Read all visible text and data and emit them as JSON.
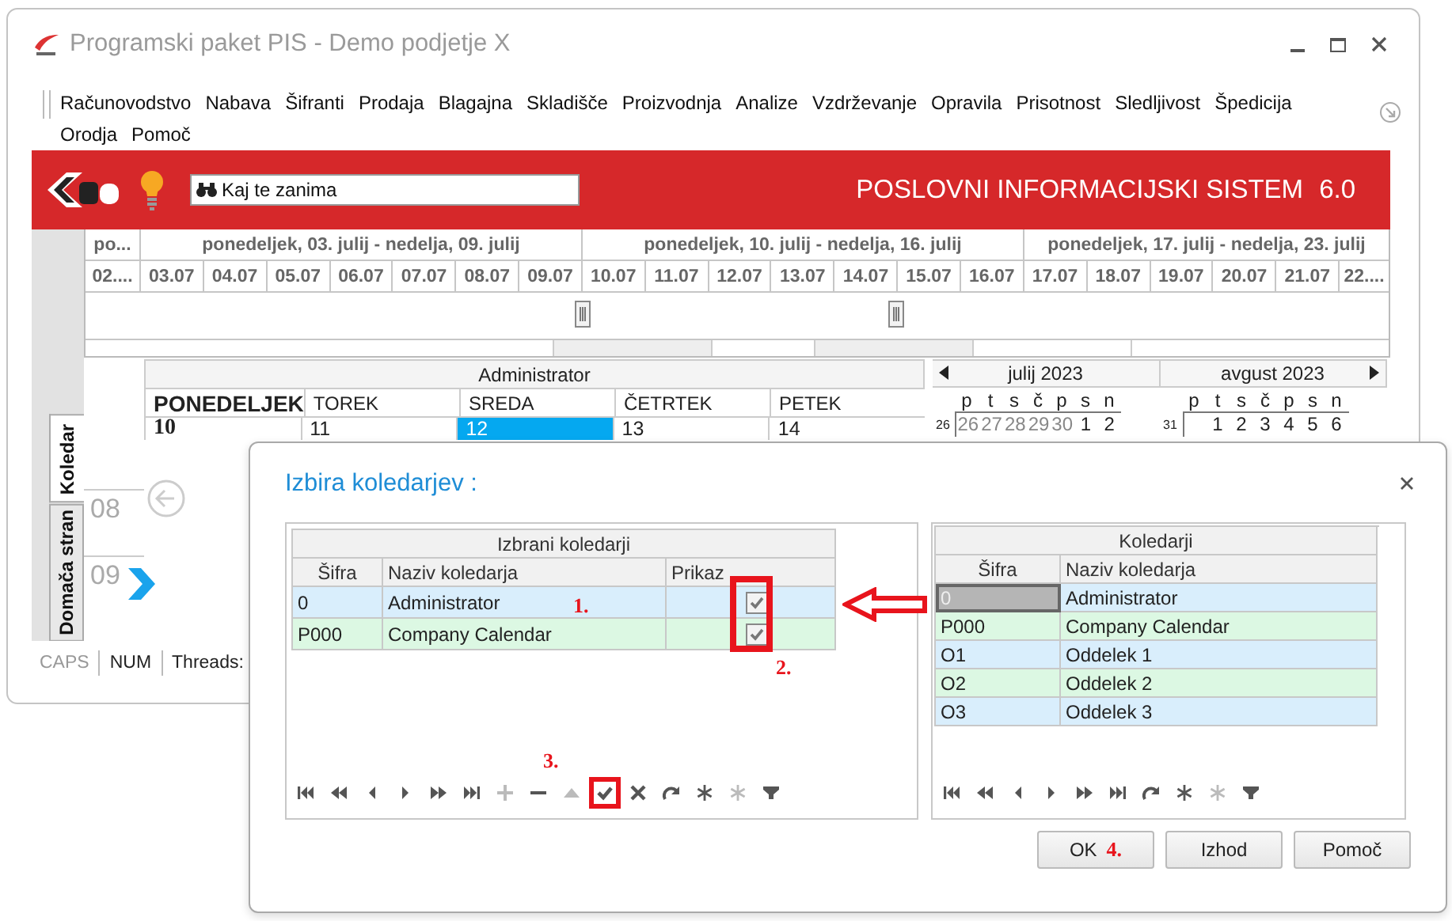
{
  "window": {
    "title": "Programski paket PIS - Demo podjetje X"
  },
  "menu": [
    "Računovodstvo",
    "Nabava",
    "Šifranti",
    "Prodaja",
    "Blagajna",
    "Skladišče",
    "Proizvodnja",
    "Analize",
    "Vzdrževanje",
    "Opravila",
    "Prisotnost",
    "Sledljivost",
    "Špedicija",
    "Orodja",
    "Pomoč"
  ],
  "header": {
    "search": {
      "placeholder": "Kaj te zanima"
    },
    "product": "POSLOVNI INFORMACIJSKI SISTEM",
    "version": "6.0"
  },
  "timeline": {
    "weeks": [
      "po...",
      "ponedeljek, 03. julij - nedelja, 09. julij",
      "ponedeljek, 10. julij - nedelja, 16. julij",
      "ponedeljek, 17. julij - nedelja, 23. julij"
    ],
    "days": [
      "02....",
      "03.07",
      "04.07",
      "05.07",
      "06.07",
      "07.07",
      "08.07",
      "09.07",
      "10.07",
      "11.07",
      "12.07",
      "13.07",
      "14.07",
      "15.07",
      "16.07",
      "17.07",
      "18.07",
      "19.07",
      "20.07",
      "21.07",
      "22...."
    ]
  },
  "side_tabs": [
    {
      "label": "Koledar",
      "selected": true
    },
    {
      "label": "Domača stran",
      "selected": false
    }
  ],
  "day_view": {
    "owner": "Administrator",
    "hours": [
      "08",
      "09"
    ],
    "days": [
      {
        "name": "PONEDELJEK",
        "date": "10",
        "today": true,
        "selected": false
      },
      {
        "name": "TOREK",
        "date": "11",
        "today": false,
        "selected": false
      },
      {
        "name": "SREDA",
        "date": "12",
        "today": false,
        "selected": true
      },
      {
        "name": "ČETRTEK",
        "date": "13",
        "today": false,
        "selected": false
      },
      {
        "name": "PETEK",
        "date": "14",
        "today": false,
        "selected": false
      }
    ]
  },
  "mini_calendars": [
    {
      "month": "julij 2023",
      "weekdays": [
        "p",
        "t",
        "s",
        "č",
        "p",
        "s",
        "n"
      ],
      "week": "26",
      "days": [
        {
          "day": "26",
          "other_month": true
        },
        {
          "day": "27",
          "other_month": true
        },
        {
          "day": "28",
          "other_month": true
        },
        {
          "day": "29",
          "other_month": true
        },
        {
          "day": "30",
          "other_month": true
        },
        {
          "day": "1",
          "other_month": false
        },
        {
          "day": "2",
          "other_month": false
        }
      ]
    },
    {
      "month": "avgust 2023",
      "weekdays": [
        "p",
        "t",
        "s",
        "č",
        "p",
        "s",
        "n"
      ],
      "week": "31",
      "days": [
        {
          "day": "1",
          "other_month": false
        },
        {
          "day": "2",
          "other_month": false
        },
        {
          "day": "3",
          "other_month": false
        },
        {
          "day": "4",
          "other_month": false
        },
        {
          "day": "5",
          "other_month": false
        },
        {
          "day": "6",
          "other_month": false
        }
      ]
    }
  ],
  "status_bar": [
    {
      "label": "CAPS",
      "active": false
    },
    {
      "label": "NUM",
      "active": true
    },
    {
      "label": "Threads:",
      "active": true
    }
  ],
  "dialog": {
    "title": "Izbira koledarjev :",
    "selected_grid": {
      "title": "Izbrani koledarji",
      "columns": [
        "Šifra",
        "Naziv koledarja",
        "Prikaz"
      ],
      "annotation": "1.",
      "checkbox_annotation": "2.",
      "rows": [
        {
          "code": "0",
          "name": "Administrator",
          "shown": true,
          "selected": false
        },
        {
          "code": "P000",
          "name": "Company Calendar",
          "shown": true,
          "selected": false
        }
      ]
    },
    "selected_toolbar": {
      "annotation": "3.",
      "tools": [
        {
          "kind": "first",
          "disabled": false,
          "highlighted": false
        },
        {
          "kind": "prev_page",
          "disabled": false,
          "highlighted": false
        },
        {
          "kind": "prev",
          "disabled": false,
          "highlighted": false
        },
        {
          "kind": "next",
          "disabled": false,
          "highlighted": false
        },
        {
          "kind": "next_page",
          "disabled": false,
          "highlighted": false
        },
        {
          "kind": "last",
          "disabled": false,
          "highlighted": false
        },
        {
          "kind": "add",
          "disabled": true,
          "highlighted": false
        },
        {
          "kind": "remove",
          "disabled": false,
          "highlighted": false
        },
        {
          "kind": "up",
          "disabled": true,
          "highlighted": false
        },
        {
          "kind": "confirm",
          "disabled": false,
          "highlighted": true
        },
        {
          "kind": "cancel",
          "disabled": false,
          "highlighted": false
        },
        {
          "kind": "refresh",
          "disabled": false,
          "highlighted": false
        },
        {
          "kind": "asterisk",
          "disabled": false,
          "highlighted": false
        },
        {
          "kind": "asterisk",
          "disabled": true,
          "highlighted": false
        },
        {
          "kind": "filter",
          "disabled": false,
          "highlighted": false
        }
      ]
    },
    "calendars_grid": {
      "title": "Koledarji",
      "columns": [
        "Šifra",
        "Naziv koledarja"
      ],
      "rows": [
        {
          "code": "0",
          "name": "Administrator",
          "selected": true
        },
        {
          "code": "P000",
          "name": "Company Calendar",
          "selected": false
        },
        {
          "code": "O1",
          "name": "Oddelek 1",
          "selected": false
        },
        {
          "code": "O2",
          "name": "Oddelek 2",
          "selected": false
        },
        {
          "code": "O3",
          "name": "Oddelek 3",
          "selected": false
        }
      ]
    },
    "calendars_toolbar": {
      "tools": [
        {
          "kind": "first",
          "disabled": false
        },
        {
          "kind": "prev_page",
          "disabled": false
        },
        {
          "kind": "prev",
          "disabled": false
        },
        {
          "kind": "next",
          "disabled": false
        },
        {
          "kind": "next_page",
          "disabled": false
        },
        {
          "kind": "last",
          "disabled": false
        },
        {
          "kind": "refresh",
          "disabled": false
        },
        {
          "kind": "asterisk",
          "disabled": false
        },
        {
          "kind": "asterisk",
          "disabled": true
        },
        {
          "kind": "filter",
          "disabled": false
        }
      ]
    },
    "buttons": [
      {
        "label": "OK",
        "annotation": "4."
      },
      {
        "label": "Izhod"
      },
      {
        "label": "Pomoč"
      }
    ]
  }
}
